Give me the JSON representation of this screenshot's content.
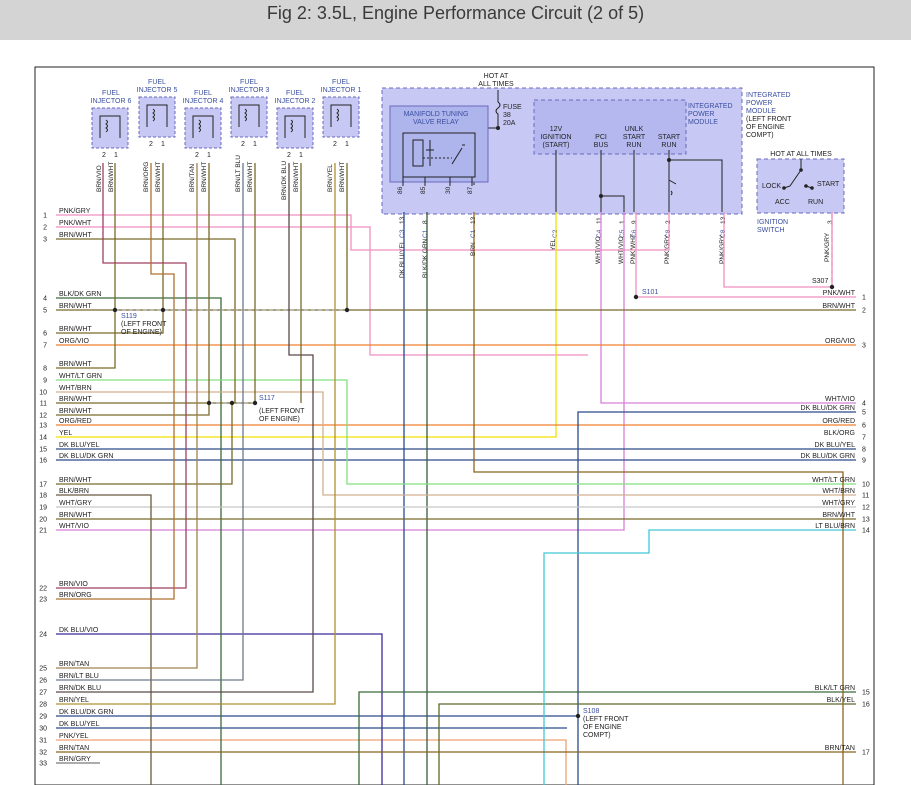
{
  "title": "Fig 2: 3.5L, Engine Performance Circuit (2 of 5)",
  "injectors": [
    {
      "label": [
        "FUEL",
        "INJECTOR 6"
      ],
      "wires": [
        "BRN/VIO",
        "BRN/WHT"
      ]
    },
    {
      "label": [
        "FUEL",
        "INJECTOR 5"
      ],
      "wires": [
        "BRN/ORG",
        "BRN/WHT"
      ]
    },
    {
      "label": [
        "FUEL",
        "INJECTOR 4"
      ],
      "wires": [
        "BRN/TAN",
        "BRN/WHT"
      ]
    },
    {
      "label": [
        "FUEL",
        "INJECTOR 3"
      ],
      "wires": [
        "BRN/LT BLU",
        "BRN/WHT"
      ]
    },
    {
      "label": [
        "FUEL",
        "INJECTOR 2"
      ],
      "wires": [
        "BRN/DK BLU",
        "BRN/WHT"
      ]
    },
    {
      "label": [
        "FUEL",
        "INJECTOR 1"
      ],
      "wires": [
        "BRN/YEL",
        "BRN/WHT"
      ]
    }
  ],
  "pin_numbers": {
    "pin1": "1",
    "pin2": "2"
  },
  "hot_at_all_times": [
    "HOT AT",
    "ALL TIMES"
  ],
  "fuse": [
    "FUSE",
    "38",
    "20A"
  ],
  "relay": {
    "label": [
      "MANIFOLD TUNING",
      "VALVE RELAY"
    ],
    "pins": [
      "86",
      "85",
      "30",
      "87"
    ]
  },
  "ipm": {
    "outer_label": [
      "INTEGRATED",
      "POWER",
      "MODULE",
      "(LEFT FRONT",
      "OF ENGINE",
      "COMPT)"
    ],
    "inner_label": [
      "INTEGRATED",
      "POWER",
      "MODULE"
    ],
    "outputs": [
      {
        "label": [
          "12V",
          "IGNITION",
          "(START)"
        ]
      },
      {
        "label": [
          "PCI",
          "BUS"
        ]
      },
      {
        "label": [
          "UNLK",
          "START",
          "RUN"
        ]
      },
      {
        "label": [
          "START",
          "RUN"
        ]
      }
    ]
  },
  "ipm_wires": [
    {
      "name": "DK BLU/YEL",
      "pin": "13",
      "conn": "C3"
    },
    {
      "name": "BLK/DK GRN",
      "pin": "8",
      "conn": "C1"
    },
    {
      "name": "BRN",
      "pin": "13",
      "conn": "C1"
    },
    {
      "name": "YEL",
      "pin": "",
      "conn": "C2"
    },
    {
      "name": "WHT/VIO",
      "pin": "11",
      "conn": "C4"
    },
    {
      "name": "WHT/VIO",
      "pin": "1",
      "conn": "C5"
    },
    {
      "name": "PNK/WHT",
      "pin": "9",
      "conn": "C6"
    },
    {
      "name": "PNK/GRY",
      "pin": "2",
      "conn": "C8"
    },
    {
      "name": "PNK/GRY",
      "pin": "13",
      "conn": "C8"
    }
  ],
  "ignition_switch": {
    "header": "HOT AT ALL TIMES",
    "positions": [
      "LOCK",
      "START",
      "ACC",
      "RUN"
    ],
    "label": [
      "IGNITION",
      "SWITCH"
    ],
    "pin": "3",
    "wire": "PNK/GRY"
  },
  "splices": {
    "s307": "S307",
    "s101": "S101",
    "s119": [
      "S119",
      "(LEFT FRONT",
      "OF ENGINE)"
    ],
    "s117": [
      "S117",
      "(LEFT FRONT",
      "OF ENGINE)"
    ],
    "s108": [
      "S108",
      "(LEFT FRONT",
      "OF ENGINE",
      "COMPT)"
    ]
  },
  "left_rows": [
    {
      "n": "1",
      "label": "PNK/GRY"
    },
    {
      "n": "2",
      "label": "PNK/WHT"
    },
    {
      "n": "3",
      "label": "BRN/WHT"
    },
    {
      "n": "4",
      "label": "BLK/DK GRN"
    },
    {
      "n": "5",
      "label": "BRN/WHT"
    },
    {
      "n": "6",
      "label": "BRN/WHT"
    },
    {
      "n": "7",
      "label": "ORG/VIO"
    },
    {
      "n": "8",
      "label": "BRN/WHT"
    },
    {
      "n": "9",
      "label": "WHT/LT GRN"
    },
    {
      "n": "10",
      "label": "WHT/BRN"
    },
    {
      "n": "11",
      "label": "BRN/WHT"
    },
    {
      "n": "12",
      "label": "BRN/WHT"
    },
    {
      "n": "13",
      "label": "ORG/RED"
    },
    {
      "n": "14",
      "label": "YEL"
    },
    {
      "n": "15",
      "label": "DK BLU/YEL"
    },
    {
      "n": "16",
      "label": "DK BLU/DK GRN"
    },
    {
      "n": "17",
      "label": "BRN/WHT"
    },
    {
      "n": "18",
      "label": "BLK/BRN"
    },
    {
      "n": "19",
      "label": "WHT/GRY"
    },
    {
      "n": "20",
      "label": "BRN/WHT"
    },
    {
      "n": "21",
      "label": "WHT/VIO"
    },
    {
      "n": "22",
      "label": "BRN/VIO"
    },
    {
      "n": "23",
      "label": "BRN/ORG"
    },
    {
      "n": "24",
      "label": "DK BLU/VIO"
    },
    {
      "n": "25",
      "label": "BRN/TAN"
    },
    {
      "n": "26",
      "label": "BRN/LT BLU"
    },
    {
      "n": "27",
      "label": "BRN/DK BLU"
    },
    {
      "n": "28",
      "label": "BRN/YEL"
    },
    {
      "n": "29",
      "label": "DK BLU/DK GRN"
    },
    {
      "n": "30",
      "label": "DK BLU/YEL"
    },
    {
      "n": "31",
      "label": "PNK/YEL"
    },
    {
      "n": "32",
      "label": "BRN/TAN"
    },
    {
      "n": "33",
      "label": "BRN/GRY"
    }
  ],
  "right_rows": [
    {
      "n": "1",
      "label": "PNK/WHT"
    },
    {
      "n": "2",
      "label": "BRN/WHT"
    },
    {
      "n": "3",
      "label": "ORG/VIO"
    },
    {
      "n": "4",
      "label": "WHT/VIO"
    },
    {
      "n": "5",
      "label": "DK BLU/DK GRN"
    },
    {
      "n": "6",
      "label": "ORG/RED"
    },
    {
      "n": "7",
      "label": "BLK/ORG"
    },
    {
      "n": "8",
      "label": "DK BLU/YEL"
    },
    {
      "n": "9",
      "label": "DK BLU/DK GRN"
    },
    {
      "n": "10",
      "label": "WHT/LT GRN"
    },
    {
      "n": "11",
      "label": "WHT/BRN"
    },
    {
      "n": "12",
      "label": "WHT/GRY"
    },
    {
      "n": "13",
      "label": "BRN/WHT"
    },
    {
      "n": "14",
      "label": "LT BLU/BRN"
    },
    {
      "n": "15",
      "label": "BLK/LT GRN"
    },
    {
      "n": "16",
      "label": "BLK/YEL"
    },
    {
      "n": "17",
      "label": "BRN/TAN"
    }
  ],
  "colors": {
    "brn": "#8b6420",
    "brn_wht": "#7a6a2a",
    "pnk": "#f090c0",
    "dkblu": "#2b4a8a",
    "dkgrn": "#3a6a3a",
    "yel": "#f2e000",
    "org": "#f08030",
    "vio": "#d070d0",
    "ltgrn": "#80e080",
    "ltblu": "#40c8d8",
    "module_fill": "#c8c8f4",
    "module_stroke": "#6a6ac0",
    "label_blue": "#3a4fa0"
  }
}
